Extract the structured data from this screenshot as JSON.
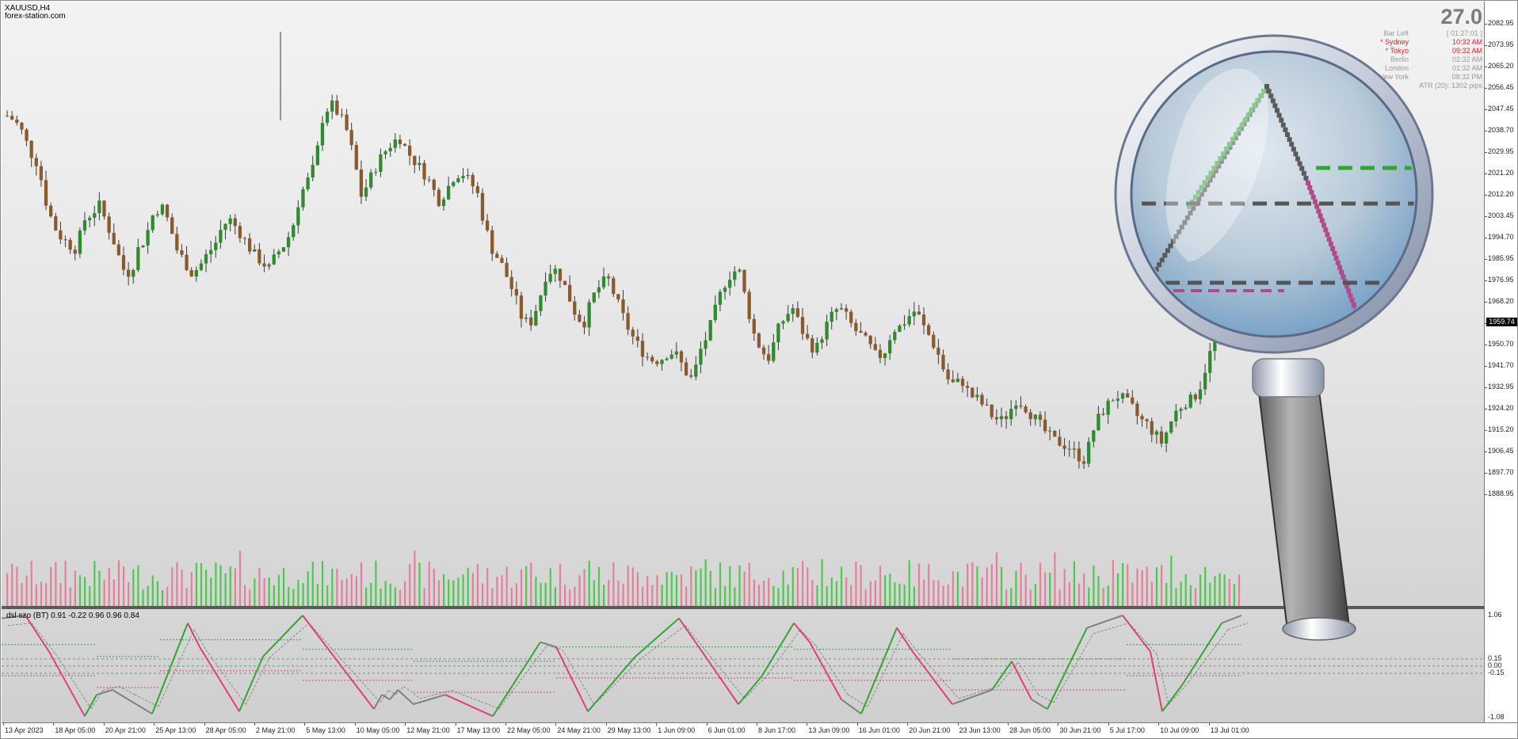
{
  "chart": {
    "symbol": "XAUUSD,H4",
    "source": "forex-station.com",
    "current_price": "1959.74"
  },
  "info_panel": {
    "big_number": "27.0",
    "rows": [
      {
        "name": "Bar Left",
        "value": "[ 01:27:01 ]",
        "color": "#9a9a9a"
      },
      {
        "name": "* Sydney",
        "value": "10:32 AM",
        "color": "#e8202a"
      },
      {
        "name": "* Tokyo",
        "value": "09:32 AM",
        "color": "#e8202a"
      },
      {
        "name": "Berlin",
        "value": "02:32 AM",
        "color": "#9a9a9a"
      },
      {
        "name": "London",
        "value": "01:32 AM",
        "color": "#9a9a9a"
      },
      {
        "name": "New York",
        "value": "08:32 PM",
        "color": "#9a9a9a"
      },
      {
        "name": "ATR (20): 1302 pips",
        "value": "",
        "color": "#9a9a9a"
      }
    ]
  },
  "indicator": {
    "label": "dsl szo (BT) 0.91 -0.22 0.96 0.96 0.84",
    "levels": [
      "1.06",
      "0.15",
      "0.00",
      "-0.15",
      "-1.08"
    ]
  },
  "price_axis": [
    "2082.95",
    "2073.95",
    "2065.20",
    "2056.45",
    "2047.45",
    "2038.70",
    "2029.95",
    "2021.20",
    "2012.20",
    "2003.45",
    "1994.70",
    "1985.95",
    "1976.95",
    "1968.20",
    "1959.45",
    "1950.70",
    "1941.70",
    "1932.95",
    "1924.20",
    "1915.20",
    "1906.45",
    "1897.70",
    "1888.95"
  ],
  "time_axis": [
    "13 Apr 2023",
    "18 Apr 05:00",
    "20 Apr 21:00",
    "25 Apr 13:00",
    "28 Apr 05:00",
    "2 May 21:00",
    "5 May 13:00",
    "10 May 05:00",
    "12 May 21:00",
    "17 May 13:00",
    "22 May 05:00",
    "24 May 21:00",
    "29 May 13:00",
    "1 Jun 09:00",
    "6 Jun 01:00",
    "8 Jun 17:00",
    "13 Jun 09:00",
    "16 Jun 01:00",
    "20 Jun 21:00",
    "23 Jun 13:00",
    "28 Jun 05:00",
    "30 Jun 21:00",
    "5 Jul 17:00",
    "10 Jul 09:00",
    "13 Jul 01:00"
  ],
  "colors": {
    "bull": "#2e8b2e",
    "bear": "#8b5a2b",
    "vol_up": "#32c832",
    "vol_down": "#e87090",
    "osc_up": "#2ea82e",
    "osc_down": "#e0407a",
    "osc_neutral": "#808080"
  },
  "chart_data": {
    "type": "candlestick",
    "price_range": [
      1888.95,
      2082.95
    ],
    "closes": [
      2045,
      2043,
      2038,
      2030,
      2025,
      2010,
      2000,
      1995,
      1992,
      1990,
      2002,
      2005,
      2008,
      2000,
      1992,
      1982,
      1980,
      1990,
      1995,
      2005,
      2008,
      2001,
      1990,
      1985,
      1980,
      1983,
      1988,
      1992,
      2000,
      2002,
      1998,
      1993,
      1988,
      1985,
      1982,
      1988,
      1992,
      1998,
      2012,
      2018,
      2025,
      2045,
      2050,
      2046,
      2040,
      2028,
      2012,
      2018,
      2025,
      2030,
      2034,
      2036,
      2030,
      2026,
      2022,
      2017,
      2010,
      2014,
      2020,
      2022,
      2018,
      2014,
      2000,
      1990,
      1985,
      1978,
      1970,
      1960,
      1960,
      1968,
      1980,
      1982,
      1978,
      1970,
      1962,
      1960,
      1970,
      1975,
      1978,
      1970,
      1962,
      1955,
      1950,
      1946,
      1944,
      1945,
      1948,
      1946,
      1940,
      1936,
      1948,
      1955,
      1965,
      1975,
      1980,
      1982,
      1968,
      1955,
      1948,
      1945,
      1956,
      1962,
      1966,
      1958,
      1952,
      1948,
      1956,
      1962,
      1966,
      1962,
      1957,
      1954,
      1950,
      1945,
      1948,
      1957,
      1958,
      1962,
      1965,
      1958,
      1953,
      1946,
      1937,
      1934,
      1936,
      1930,
      1928,
      1925,
      1921,
      1919,
      1922,
      1928,
      1926,
      1922,
      1918,
      1914,
      1911,
      1910,
      1908,
      1905,
      1903,
      1915,
      1922,
      1926,
      1930,
      1928,
      1925,
      1920,
      1918,
      1914,
      1910,
      1918,
      1924,
      1927,
      1928,
      1934,
      1945,
      1954,
      1958,
      1960,
      1959
    ]
  }
}
